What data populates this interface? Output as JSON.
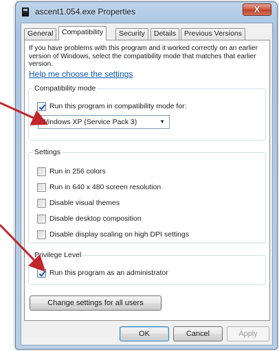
{
  "window": {
    "title": "ascent1.054.exe Properties",
    "close_glyph": "X"
  },
  "tabs": [
    {
      "label": "General",
      "active": false
    },
    {
      "label": "Compatibility",
      "active": true
    },
    {
      "label": "Security",
      "active": false
    },
    {
      "label": "Details",
      "active": false
    },
    {
      "label": "Previous Versions",
      "active": false
    }
  ],
  "compatibility": {
    "intro": "If you have problems with this program and it worked correctly on an earlier version of Windows, select the compatibility mode that matches that earlier version.",
    "help_link": "Help me choose the settings",
    "mode_group": {
      "title": "Compatibility mode",
      "checkbox_label": "Run this program in compatibility mode for:",
      "checked": true,
      "selected_os": "Windows XP (Service Pack 3)"
    },
    "settings_group": {
      "title": "Settings",
      "items": [
        {
          "label": "Run in 256 colors",
          "checked": false
        },
        {
          "label": "Run in 640 x 480 screen resolution",
          "checked": false
        },
        {
          "label": "Disable visual themes",
          "checked": false
        },
        {
          "label": "Disable desktop composition",
          "checked": false
        },
        {
          "label": "Disable display scaling on high DPI settings",
          "checked": false
        }
      ]
    },
    "privilege_group": {
      "title": "Privilege Level",
      "checkbox_label": "Run this program as an administrator",
      "checked": true
    },
    "change_all_users_label": "Change settings for all users"
  },
  "buttons": {
    "ok": "OK",
    "cancel": "Cancel",
    "apply": "Apply"
  },
  "colors": {
    "annotation_arrow": "#c0262c",
    "link": "#0b57b5"
  },
  "icons": {
    "app": "exe-file-icon",
    "close": "close-icon",
    "dropdown": "chevron-down-icon"
  }
}
